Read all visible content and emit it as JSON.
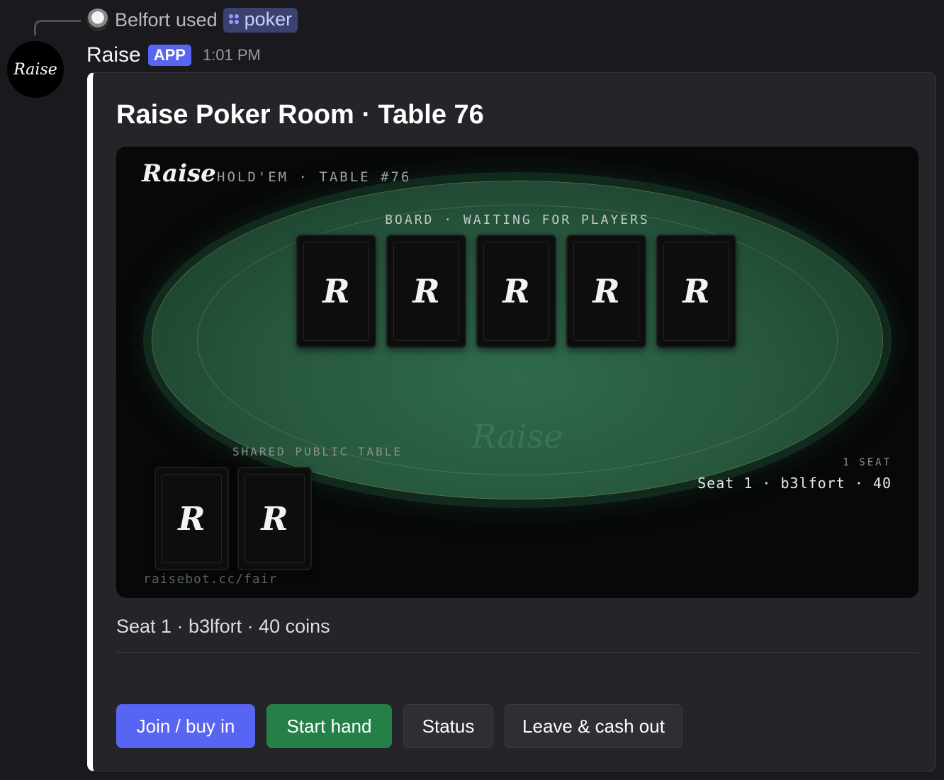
{
  "reply": {
    "user": "Belfort",
    "used_text": "used",
    "command": "poker",
    "command_icon": "slash-command-icon"
  },
  "message": {
    "avatar_text": "Raise",
    "username": "Raise",
    "badge": "APP",
    "timestamp": "1:01 PM"
  },
  "embed": {
    "accent_color": "#ffffff",
    "title": "Raise Poker Room · Table 76",
    "description": "Seat 1 · b3lfort · 40 coins"
  },
  "table_image": {
    "brand": "Raise",
    "subtitle": "HOLD'EM · TABLE #76",
    "board_label": "BOARD · WAITING FOR PLAYERS",
    "board_cards": [
      "R",
      "R",
      "R",
      "R",
      "R"
    ],
    "watermark": "Raise",
    "shared_label": "SHARED PUBLIC TABLE",
    "hand_cards": [
      "R",
      "R"
    ],
    "seat_count": "1 SEAT",
    "seat_line": "Seat 1 · b3lfort · 40",
    "fair_url": "raisebot.cc/fair",
    "felt_color": "#28593f"
  },
  "buttons": {
    "join": "Join / buy in",
    "start": "Start hand",
    "status": "Status",
    "leave": "Leave & cash out"
  },
  "colors": {
    "blurple": "#5865f2",
    "green": "#248046",
    "background": "#1a1a1e",
    "embed_background": "#242429"
  }
}
